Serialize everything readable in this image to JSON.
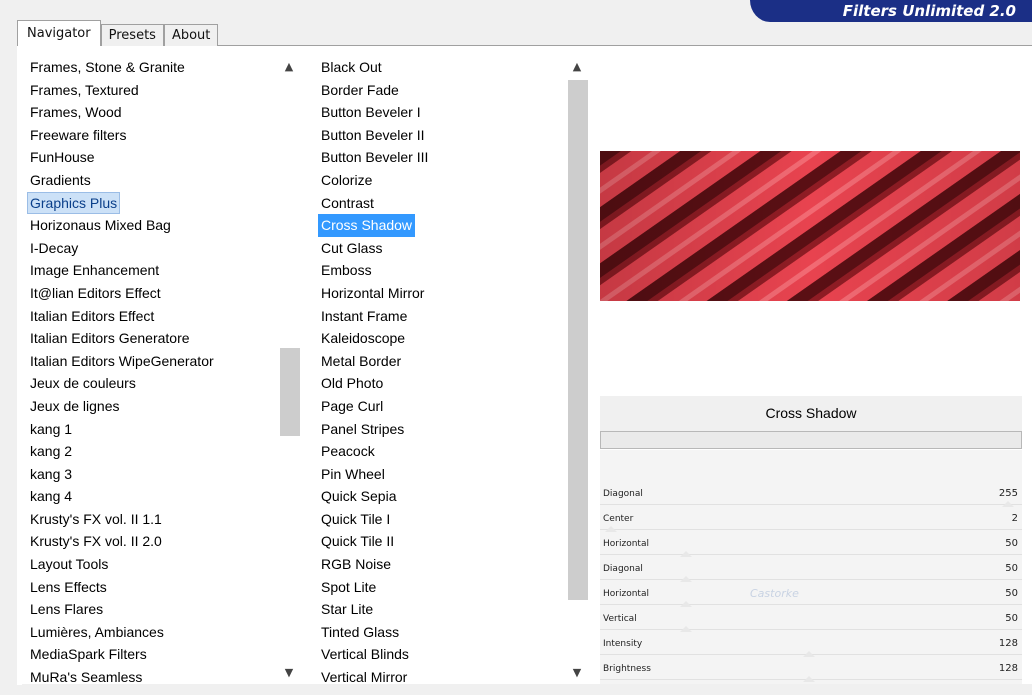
{
  "brand": "Filters Unlimited 2.0",
  "tabs": [
    "Navigator",
    "Presets",
    "About"
  ],
  "categories": [
    "Frames, Stone & Granite",
    "Frames, Textured",
    "Frames, Wood",
    "Freeware filters",
    "FunHouse",
    "Gradients",
    "Graphics Plus",
    "Horizonaus Mixed Bag",
    "I-Decay",
    "Image Enhancement",
    "It@lian Editors Effect",
    "Italian Editors Effect",
    "Italian Editors Generatore",
    "Italian Editors WipeGenerator",
    "Jeux de couleurs",
    "Jeux de lignes",
    "kang 1",
    "kang 2",
    "kang 3",
    "kang 4",
    "Krusty's FX vol. II 1.1",
    "Krusty's FX vol. II 2.0",
    "Layout Tools",
    "Lens Effects",
    "Lens Flares",
    "Lumières, Ambiances",
    "MediaSpark Filters",
    "MuRa's Seamless"
  ],
  "selected_category": "Graphics Plus",
  "filters": [
    "Black Out",
    "Border Fade",
    "Button Beveler I",
    "Button Beveler II",
    "Button Beveler III",
    "Colorize",
    "Contrast",
    "Cross Shadow",
    "Cut Glass",
    "Emboss",
    "Horizontal Mirror",
    "Instant Frame",
    "Kaleidoscope",
    "Metal Border",
    "Old Photo",
    "Page Curl",
    "Panel Stripes",
    "Peacock",
    "Pin Wheel",
    "Quick Sepia",
    "Quick Tile I",
    "Quick Tile II",
    "RGB Noise",
    "Spot Lite",
    "Star Lite",
    "Tinted Glass",
    "Vertical Blinds",
    "Vertical Mirror"
  ],
  "selected_filter": "Cross Shadow",
  "filter_name": "Cross Shadow",
  "params": [
    {
      "label": "Diagonal",
      "value": "255",
      "max": 255
    },
    {
      "label": "Center",
      "value": "2",
      "max": 255
    },
    {
      "label": "Horizontal",
      "value": "50",
      "max": 255
    },
    {
      "label": "Diagonal",
      "value": "50",
      "max": 255
    },
    {
      "label": "Horizontal",
      "value": "50",
      "max": 255
    },
    {
      "label": "Vertical",
      "value": "50",
      "max": 255
    },
    {
      "label": "Intensity",
      "value": "128",
      "max": 255
    },
    {
      "label": "Brightness",
      "value": "128",
      "max": 255
    }
  ],
  "watermark": "Castorke",
  "colors": {
    "brand_bg": "#1b2f86",
    "selection": "#3399ff",
    "preview_red": "#e8434f"
  }
}
